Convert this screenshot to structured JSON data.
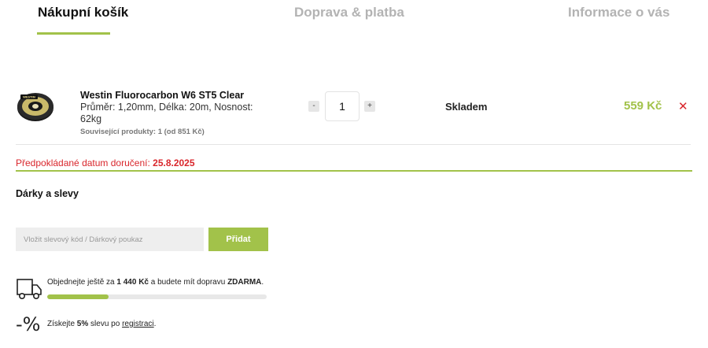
{
  "steps": {
    "items": [
      {
        "label": "Nákupní košík",
        "active": true
      },
      {
        "label": "Doprava & platba",
        "active": false
      },
      {
        "label": "Informace o vás",
        "active": false
      }
    ]
  },
  "cart": {
    "item": {
      "name": "Westin Fluorocarbon W6 ST5 Clear",
      "params": "Průměr: 1,20mm, Délka: 20m, Nosnost: 62kg",
      "related": "Související produkty: 1 (od 851 Kč)",
      "qty_minus": "-",
      "qty_plus": "+",
      "quantity": "1",
      "stock": "Skladem",
      "price": "559 Kč",
      "remove": "✕",
      "thumb_icon": "fishing-line-spool-icon",
      "thumb_brand": "WESTIN"
    }
  },
  "delivery": {
    "label": "Předpokládané datum doručení:",
    "date": "25.8.2025"
  },
  "gifts": {
    "title": "Dárky a slevy",
    "placeholder": "Vložit slevový kód / Dárkový poukaz",
    "button": "Přidat"
  },
  "shipping": {
    "icon": "truck-icon",
    "prefix": "Objednejte ještě za",
    "amount": "1 440 Kč",
    "middle": "a budete mít dopravu",
    "free": "ZDARMA",
    "suffix": ".",
    "progress_fraction": 0.28
  },
  "discount": {
    "symbol": "-%",
    "prefix": "Získejte",
    "percent": "5%",
    "middle": "slevu po",
    "link": "registraci",
    "suffix": "."
  },
  "colors": {
    "accent": "#a2c24a",
    "danger": "#d9262c",
    "muted": "#b3b3b3"
  }
}
